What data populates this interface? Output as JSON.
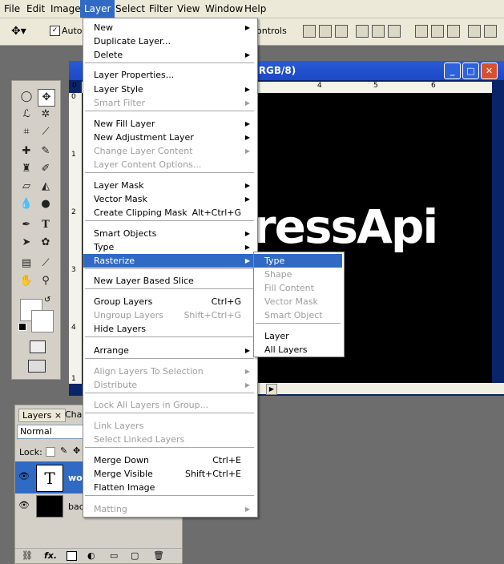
{
  "menubar": {
    "items": [
      "File",
      "Edit",
      "Image",
      "Layer",
      "Select",
      "Filter",
      "View",
      "Window",
      "Help"
    ],
    "active": "Layer"
  },
  "options_bar": {
    "auto_label": "Auto",
    "controls_label": "ontrols"
  },
  "document": {
    "title_fragment": ", RGB/8)",
    "canvas_text": "ressApi",
    "ruler_top_ticks": [
      "0",
      "4",
      "5",
      "6"
    ],
    "ruler_left_ticks": [
      "0",
      "1",
      "2",
      "3",
      "4",
      "1"
    ]
  },
  "layers_panel": {
    "tab_layers": "Layers",
    "tab_close": "×",
    "tab_other": "Cha",
    "blend_mode": "Normal",
    "lock_label": "Lock:",
    "rows": [
      {
        "thumb": "T",
        "name": "wo"
      },
      {
        "thumb": "",
        "name": "bac"
      }
    ],
    "fx_label": "fx."
  },
  "layer_menu": {
    "items": [
      {
        "label": "New",
        "shortcut": "",
        "submenu": true,
        "disabled": false
      },
      {
        "label": "Duplicate Layer...",
        "shortcut": "",
        "submenu": false,
        "disabled": false
      },
      {
        "label": "Delete",
        "shortcut": "",
        "submenu": true,
        "disabled": false
      },
      {
        "label": "Layer Properties...",
        "shortcut": "",
        "submenu": false,
        "disabled": false
      },
      {
        "label": "Layer Style",
        "shortcut": "",
        "submenu": true,
        "disabled": false
      },
      {
        "label": "Smart Filter",
        "shortcut": "",
        "submenu": true,
        "disabled": true
      },
      {
        "label": "New Fill Layer",
        "shortcut": "",
        "submenu": true,
        "disabled": false
      },
      {
        "label": "New Adjustment Layer",
        "shortcut": "",
        "submenu": true,
        "disabled": false
      },
      {
        "label": "Change Layer Content",
        "shortcut": "",
        "submenu": true,
        "disabled": true
      },
      {
        "label": "Layer Content Options...",
        "shortcut": "",
        "submenu": false,
        "disabled": true
      },
      {
        "label": "Layer Mask",
        "shortcut": "",
        "submenu": true,
        "disabled": false
      },
      {
        "label": "Vector Mask",
        "shortcut": "",
        "submenu": true,
        "disabled": false
      },
      {
        "label": "Create Clipping Mask",
        "shortcut": "Alt+Ctrl+G",
        "submenu": false,
        "disabled": false
      },
      {
        "label": "Smart Objects",
        "shortcut": "",
        "submenu": true,
        "disabled": false
      },
      {
        "label": "Type",
        "shortcut": "",
        "submenu": true,
        "disabled": false
      },
      {
        "label": "Rasterize",
        "shortcut": "",
        "submenu": true,
        "disabled": false,
        "highlighted": true
      },
      {
        "label": "New Layer Based Slice",
        "shortcut": "",
        "submenu": false,
        "disabled": false
      },
      {
        "label": "Group Layers",
        "shortcut": "Ctrl+G",
        "submenu": false,
        "disabled": false
      },
      {
        "label": "Ungroup Layers",
        "shortcut": "Shift+Ctrl+G",
        "submenu": false,
        "disabled": true
      },
      {
        "label": "Hide Layers",
        "shortcut": "",
        "submenu": false,
        "disabled": false
      },
      {
        "label": "Arrange",
        "shortcut": "",
        "submenu": true,
        "disabled": false
      },
      {
        "label": "Align Layers To Selection",
        "shortcut": "",
        "submenu": true,
        "disabled": true
      },
      {
        "label": "Distribute",
        "shortcut": "",
        "submenu": true,
        "disabled": true
      },
      {
        "label": "Lock All Layers in Group...",
        "shortcut": "",
        "submenu": false,
        "disabled": true
      },
      {
        "label": "Link Layers",
        "shortcut": "",
        "submenu": false,
        "disabled": true
      },
      {
        "label": "Select Linked Layers",
        "shortcut": "",
        "submenu": false,
        "disabled": true
      },
      {
        "label": "Merge Down",
        "shortcut": "Ctrl+E",
        "submenu": false,
        "disabled": false
      },
      {
        "label": "Merge Visible",
        "shortcut": "Shift+Ctrl+E",
        "submenu": false,
        "disabled": false
      },
      {
        "label": "Flatten Image",
        "shortcut": "",
        "submenu": false,
        "disabled": false
      },
      {
        "label": "Matting",
        "shortcut": "",
        "submenu": true,
        "disabled": true
      }
    ]
  },
  "rasterize_submenu": {
    "items": [
      {
        "label": "Type",
        "disabled": false,
        "highlighted": true
      },
      {
        "label": "Shape",
        "disabled": true
      },
      {
        "label": "Fill Content",
        "disabled": true
      },
      {
        "label": "Vector Mask",
        "disabled": true
      },
      {
        "label": "Smart Object",
        "disabled": true
      },
      {
        "label": "Layer",
        "disabled": false
      },
      {
        "label": "All Layers",
        "disabled": false
      }
    ]
  },
  "colors": {
    "menu_highlight": "#316ac5",
    "disabled_text": "#9d9d9d",
    "menubar_bg": "#ece9d8"
  }
}
